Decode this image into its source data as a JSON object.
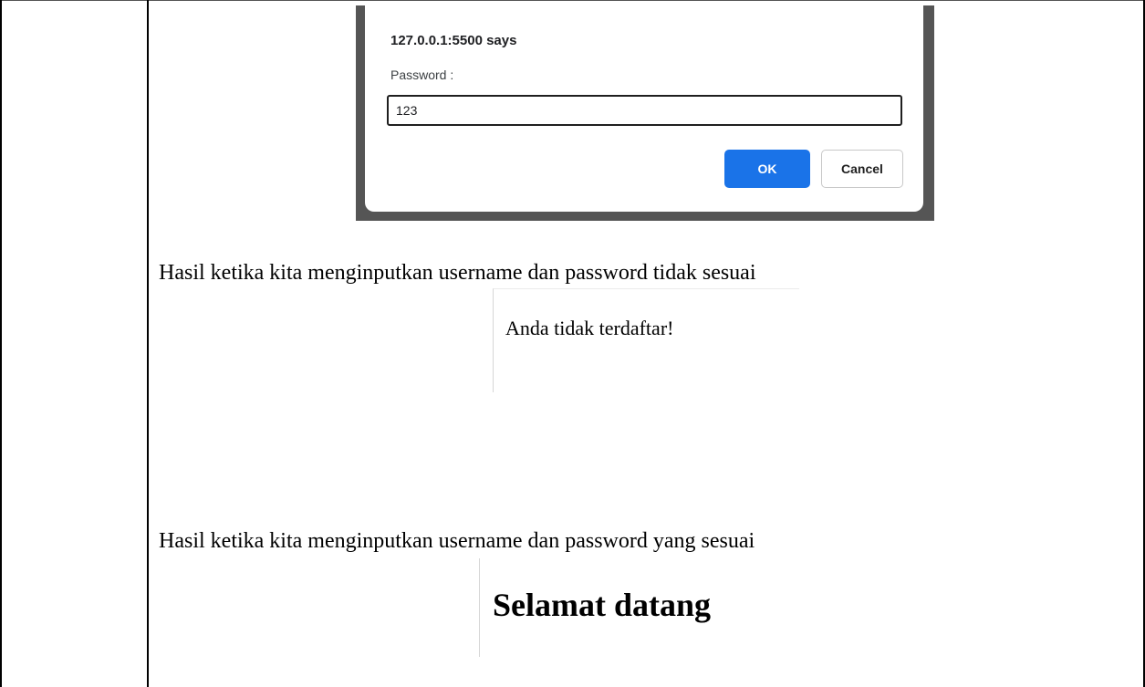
{
  "prompt_dialog": {
    "title": "127.0.0.1:5500 says",
    "message": "Password :",
    "input_value": "123",
    "ok_label": "OK",
    "cancel_label": "Cancel",
    "ok_color": "#1a73e8"
  },
  "document": {
    "text_fail": "Hasil ketika kita menginputkan username dan password tidak sesuai",
    "result_fail": "Anda tidak terdaftar!",
    "text_success": "Hasil ketika kita menginputkan username dan password yang sesuai",
    "result_success": "Selamat datang"
  }
}
